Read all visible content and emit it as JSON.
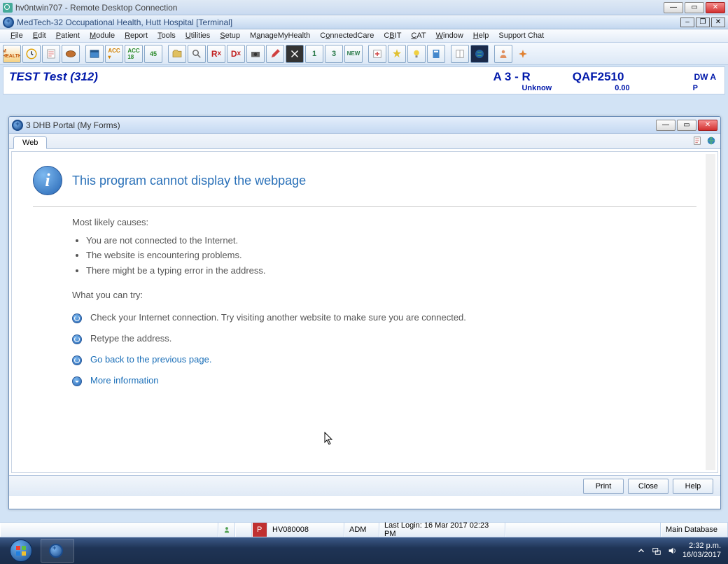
{
  "rdp": {
    "title": "hv0ntwin707 - Remote Desktop Connection"
  },
  "app": {
    "title": "MedTech-32  Occupational Health, Hutt Hospital  [Terminal]"
  },
  "menu": [
    "File",
    "Edit",
    "Patient",
    "Module",
    "Report",
    "Tools",
    "Utilities",
    "Setup",
    "ManageMyHealth",
    "ConnectedCare",
    "CBIT",
    "CAT",
    "Window",
    "Help",
    "Support Chat"
  ],
  "patient": {
    "name": "TEST Test (312)",
    "a3": "A 3  -  R",
    "qaf": "QAF2510",
    "dw": "DW A",
    "sub_unknown": "Unknow",
    "sub_amount": "0.00",
    "sub_p": "P"
  },
  "inner": {
    "title": "3 DHB Portal (My Forms)",
    "tab": "Web",
    "error_title": "This program cannot display the webpage",
    "causes_heading": "Most likely causes:",
    "causes": [
      "You are not connected to the Internet.",
      "The website is encountering problems.",
      "There might be a typing error in the address."
    ],
    "try_heading": "What you can try:",
    "try_items": [
      "Check your Internet connection. Try visiting another website to make sure you are connected.",
      "Retype the address."
    ],
    "try_link_back": "Go back to the previous page.",
    "try_link_more": "More information",
    "buttons": {
      "print": "Print",
      "close": "Close",
      "help": "Help"
    }
  },
  "status": {
    "user": "HV080008",
    "role": "ADM",
    "last_login": "Last Login: 16 Mar 2017 02:23 PM",
    "db": "Main Database"
  },
  "tray": {
    "time": "2:32 p.m.",
    "date": "16/03/2017"
  }
}
